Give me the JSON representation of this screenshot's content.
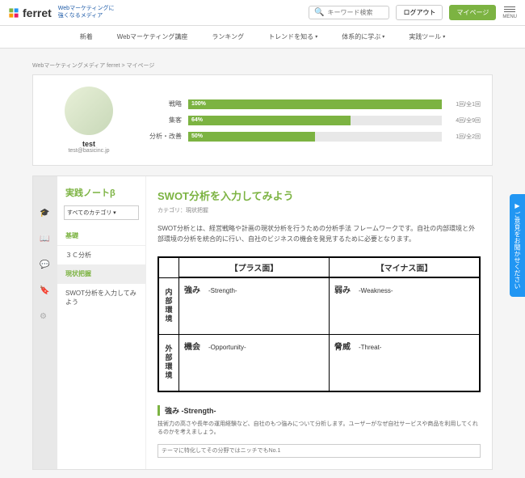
{
  "header": {
    "logo_text": "ferret",
    "tagline_l1": "Webマーケティングに",
    "tagline_l2": "強くなるメディア",
    "search_placeholder": "キーワード検索",
    "logout": "ログアウト",
    "mypage": "マイページ",
    "menu": "MENU"
  },
  "nav": {
    "items": [
      "新着",
      "Webマーケティング講座",
      "ランキング",
      "トレンドを知る",
      "体系的に学ぶ",
      "実践ツール"
    ]
  },
  "breadcrumb": {
    "root": "Webマーケティングメディア ferret",
    "sep": ">",
    "current": "マイページ"
  },
  "profile": {
    "name": "test",
    "email": "test@basicinc.jp"
  },
  "progress": [
    {
      "label": "戦略",
      "pct": "100%",
      "width": "100%",
      "count": "1回/全1回"
    },
    {
      "label": "集客",
      "pct": "64%",
      "width": "64%",
      "count": "4回/全9回"
    },
    {
      "label": "分析・改善",
      "pct": "50%",
      "width": "50%",
      "count": "1回/全2回"
    }
  ],
  "sidebar": {
    "title": "実践ノートβ",
    "select": "すべてのカテゴリ",
    "group1": "基礎",
    "item1": "３Ｃ分析",
    "group2": "現状把握",
    "item2": "SWOT分析を入力してみよう"
  },
  "content": {
    "title": "SWOT分析を入力してみよう",
    "category": "カテゴリ：現状把握",
    "desc": "SWOT分析とは、経営戦略や計画の現状分析を行うための分析手法 フレームワークです。自社の内部環境と外部環境の分析を統合的に行い、自社のビジネスの機会を発見するために必要となります。",
    "swot": {
      "plus": "【プラス面】",
      "minus": "【マイナス面】",
      "internal": "内部環境",
      "external": "外部環境",
      "s_title": "強み",
      "s_sub": "-Strength-",
      "w_title": "弱み",
      "w_sub": "-Weakness-",
      "o_title": "機会",
      "o_sub": "-Opportunity-",
      "t_title": "脅威",
      "t_sub": "-Threat-"
    },
    "sub_title": "強み -Strength-",
    "sub_desc": "技術力の高さや長年の運用経験など、自社のもつ強みについて分析します。ユーザーがなぜ自社サービスや商品を利用してくれるのかを考えましょう。",
    "input_placeholder": "テーマに特化してその分野ではニッチでもNo.1"
  },
  "feedback": "▶ ご意見をお聞かせください"
}
